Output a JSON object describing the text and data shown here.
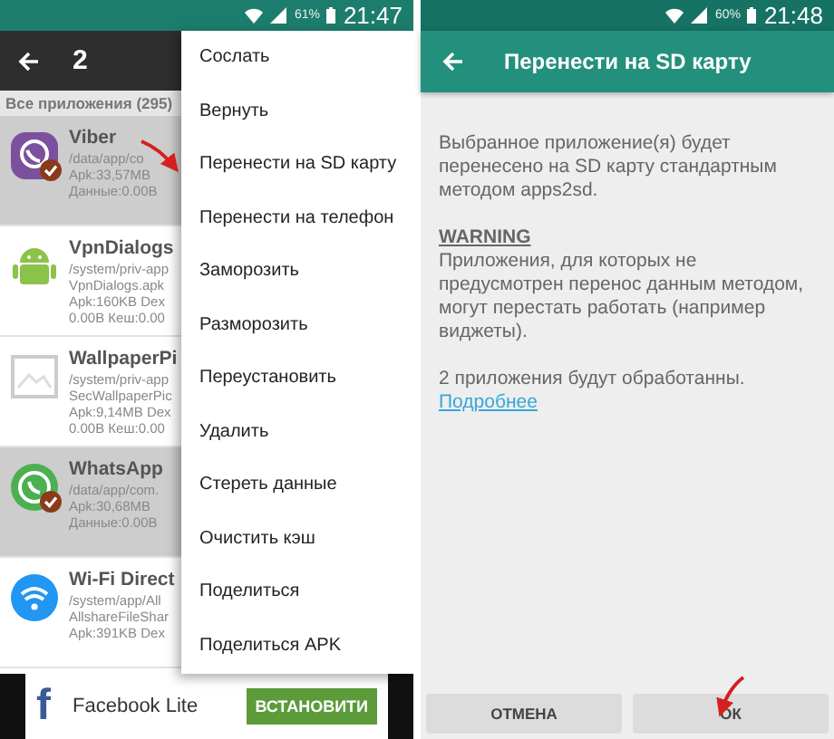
{
  "left_screen": {
    "status_bar": {
      "battery": "61%",
      "time": "21:47"
    },
    "toolbar": {
      "title": "2"
    },
    "list_header": "Все приложения (295)",
    "apps": [
      {
        "name": "Viber",
        "kind": "viber",
        "selected": true,
        "lines": [
          "/data/app/co",
          "Apk:33,57MB",
          "Данные:0.00B"
        ]
      },
      {
        "name": "VpnDialogs",
        "kind": "android",
        "selected": false,
        "lines": [
          "/system/priv-app",
          "VpnDialogs.apk",
          "Apk:160KB Dex",
          "0.00B Кеш:0.00"
        ]
      },
      {
        "name": "WallpaperPi",
        "kind": "picture",
        "selected": false,
        "lines": [
          "/system/priv-app",
          "SecWallpaperPic",
          "Apk:9,14MB Dex",
          "0.00B Кеш:0.00"
        ]
      },
      {
        "name": "WhatsApp",
        "kind": "whatsapp",
        "selected": true,
        "lines": [
          "/data/app/com.",
          "Apk:30,68MB",
          "Данные:0.00B"
        ]
      },
      {
        "name": "Wi-Fi Direct",
        "kind": "wifi",
        "selected": false,
        "lines": [
          "/system/app/All",
          "AllshareFileShar",
          "Apk:391KB Dex"
        ]
      }
    ],
    "menu": {
      "items": [
        "Сослать",
        "Вернуть",
        "Перенести на SD карту",
        "Перенести на телефон",
        "Заморозить",
        "Разморозить",
        "Переустановить",
        "Удалить",
        "Стереть данные",
        "Очистить кэш",
        "Поделиться",
        "Поделиться APK"
      ]
    },
    "ad": {
      "logo": "f",
      "title": "Facebook Lite",
      "button": "ВСТАНОВИТИ"
    }
  },
  "right_screen": {
    "status_bar": {
      "battery": "60%",
      "time": "21:48"
    },
    "toolbar": {
      "title": "Перенести на SD карту"
    },
    "message": "Выбранное приложение(я) будет перенесено на SD карту стандартным методом apps2sd.",
    "warning_title": "WARNING",
    "warning_text": "Приложения, для которых не предусмотрен перенос данным методом, могут перестать работать (например виджеты).",
    "count_text": "2 приложения будут обработанны.",
    "link": "Подробнее",
    "buttons": [
      "ОТМЕНА",
      "ОК"
    ]
  }
}
